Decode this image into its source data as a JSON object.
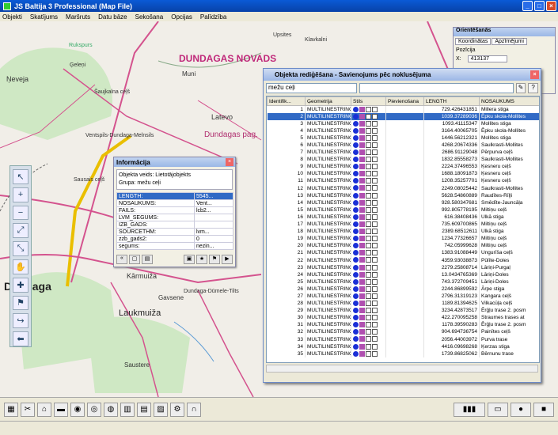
{
  "window": {
    "title": "JS Baltija 3 Professional (Map File)"
  },
  "menu": [
    "Objekti",
    "Skatījums",
    "Maršruts",
    "Datu bāze",
    "Sekošana",
    "Opcijas",
    "Palīdzība"
  ],
  "map": {
    "labels": [
      "DUNDAGAS NOVADS",
      "Dundagas pag.",
      "Dundaga",
      "Laukmuiža",
      "Kārmuiža",
      "Upsites",
      "Klavkalni",
      "Rukspurs",
      "Ņeveja",
      "Šaujkalna ceļš",
      "Ventspils-Dundaga-Melnsils",
      "Sausais ceļš",
      "Gavsene",
      "Saustere",
      "Dundaga-Dūmele-Tilts",
      "Ģeleņi",
      "Latevo",
      "Muni"
    ]
  },
  "orient": {
    "title": "Orientēšanās",
    "tabs": [
      "Koordinātas",
      "Apzīmējumi"
    ],
    "pos_label": "Pozīcija",
    "x_label": "X:",
    "x_value": "413137"
  },
  "info": {
    "title": "Informācija",
    "obj_line1": "Objekta veids: Lietotājobjekts",
    "obj_line2": "Grupa: mežu ceļi",
    "rows": [
      {
        "k": "LENGTH:",
        "v": "5545..."
      },
      {
        "k": "NOSAUKUMS:",
        "v": "Vent..."
      },
      {
        "k": "FAILS:",
        "v": "lcb2..."
      },
      {
        "k": "LVM_SEGUMS:",
        "v": ""
      },
      {
        "k": "IZB_GADS:",
        "v": ""
      },
      {
        "k": "SOURCETHM:",
        "v": "lvm..."
      },
      {
        "k": "zzb_gads2:",
        "v": "0"
      },
      {
        "k": "segums:",
        "v": "nezin..."
      }
    ]
  },
  "edit": {
    "title": "Objekta rediģēšana - Savienojums pēc noklusējuma",
    "filter": "mežu ceļi",
    "columns": [
      "Identifik...",
      "Ģeometrija",
      "Stils",
      "Pievienošana",
      "LENGTH",
      "NOSAUKUMS"
    ],
    "geom": "MULTILINESTRING(",
    "rows": [
      {
        "id": "1",
        "len": "729.426431851",
        "name": "Millera stiga"
      },
      {
        "id": "2",
        "len": "1039.37289036",
        "name": "Ēpku skola-Mollites"
      },
      {
        "id": "3",
        "len": "1093.41115347",
        "name": "Mollites stiga"
      },
      {
        "id": "4",
        "len": "3164.40065705",
        "name": "Ēpku skola-Mollites"
      },
      {
        "id": "5",
        "len": "1446.56212321",
        "name": "Mollites stiga"
      },
      {
        "id": "6",
        "len": "4268.20674336",
        "name": "Saulkrasti-Mollites"
      },
      {
        "id": "7",
        "len": "2686.91129048",
        "name": "Pērpurva ceļš"
      },
      {
        "id": "8",
        "len": "1832.85558273",
        "name": "Saulkrasti-Mollites"
      },
      {
        "id": "9",
        "len": "2224.37496553",
        "name": "Ķesneru ceļš"
      },
      {
        "id": "10",
        "len": "1688.18091873",
        "name": "Ķesneru ceļš"
      },
      {
        "id": "11",
        "len": "1208.35257701",
        "name": "Ķesneru ceļš"
      },
      {
        "id": "12",
        "len": "2249.08025442",
        "name": "Saulkrasti-Mollites"
      },
      {
        "id": "13",
        "len": "5628.54860889",
        "name": "Raudītes-Rīļļi"
      },
      {
        "id": "14",
        "len": "928.580347681",
        "name": "Smēdīte-Jauncāļa"
      },
      {
        "id": "15",
        "len": "992.805778195",
        "name": "Miltiņu ceļš"
      },
      {
        "id": "16",
        "len": "616.38408436",
        "name": "Ulkā stiga"
      },
      {
        "id": "17",
        "len": "735.609700865",
        "name": "Miltiņu ceļš"
      },
      {
        "id": "18",
        "len": "2389.68512611",
        "name": "Ulkā stiga"
      },
      {
        "id": "19",
        "len": "1234.77326657",
        "name": "Miltiņu ceļš"
      },
      {
        "id": "20",
        "len": "742.05999628",
        "name": "Miltiņu ceļš"
      },
      {
        "id": "21",
        "len": "1383.91088449",
        "name": "Ungurīša ceļš"
      },
      {
        "id": "22",
        "len": "4359.93038873",
        "name": "Pūlīte-Doles"
      },
      {
        "id": "23",
        "len": "2279.25808714",
        "name": "Lāriņi-Purgaļ"
      },
      {
        "id": "24",
        "len": "13.0434765369",
        "name": "Lāriņi-Doles"
      },
      {
        "id": "25",
        "len": "743.372709451",
        "name": "Lāriņi-Doles"
      },
      {
        "id": "26",
        "len": "2244.86899592",
        "name": "Ārpe stiga"
      },
      {
        "id": "27",
        "len": "2796.31319123",
        "name": "Kangara ceļš"
      },
      {
        "id": "28",
        "len": "1189.81394625",
        "name": "Vilkacūļa ceļš"
      },
      {
        "id": "29",
        "len": "3234.42873517",
        "name": "Ērģļu trase 2. posm"
      },
      {
        "id": "30",
        "len": "422.270095258",
        "name": "Straumes trases at"
      },
      {
        "id": "31",
        "len": "1178.39590283",
        "name": "Ērģļu trase 2. posm"
      },
      {
        "id": "32",
        "len": "904.694736754",
        "name": "Painītes ceļš"
      },
      {
        "id": "33",
        "len": "2056.44003972",
        "name": "Purva trase"
      },
      {
        "id": "34",
        "len": "4416.09698268",
        "name": "Ķerzas stiga"
      },
      {
        "id": "35",
        "len": "1739.86825062",
        "name": "Bērnunu trase"
      }
    ],
    "selected_row": "2"
  },
  "colors": {
    "accent": "#316ac5",
    "title": "#0a5ad6",
    "road_main": "#e6c200",
    "road_pink": "#d4538e"
  }
}
